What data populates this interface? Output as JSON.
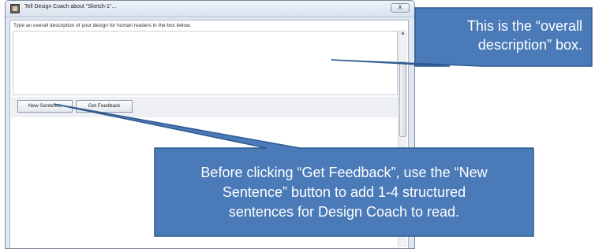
{
  "window": {
    "title": "Tell Design Coach about \"Sketch-1\"...",
    "app_icon": "design-coach-app-icon",
    "close_label": "X"
  },
  "dialog": {
    "instruction": "Type an overall description of your design for human readers in the box below.",
    "description_value": "",
    "buttons": {
      "new_sentence": "New Sentence",
      "get_feedback": "Get Feedback"
    }
  },
  "callouts": {
    "top_line1": "This is the “overall",
    "top_line2": "description” box.",
    "bottom_line1": "Before clicking “Get Feedback”, use the “New",
    "bottom_line2": "Sentence” button to add 1-4 structured",
    "bottom_line3": "sentences for Design Coach to read."
  },
  "colors": {
    "callout_fill": "#4a7ab8",
    "callout_border": "#2f5a8f",
    "window_frame": "#dfe8f2"
  }
}
